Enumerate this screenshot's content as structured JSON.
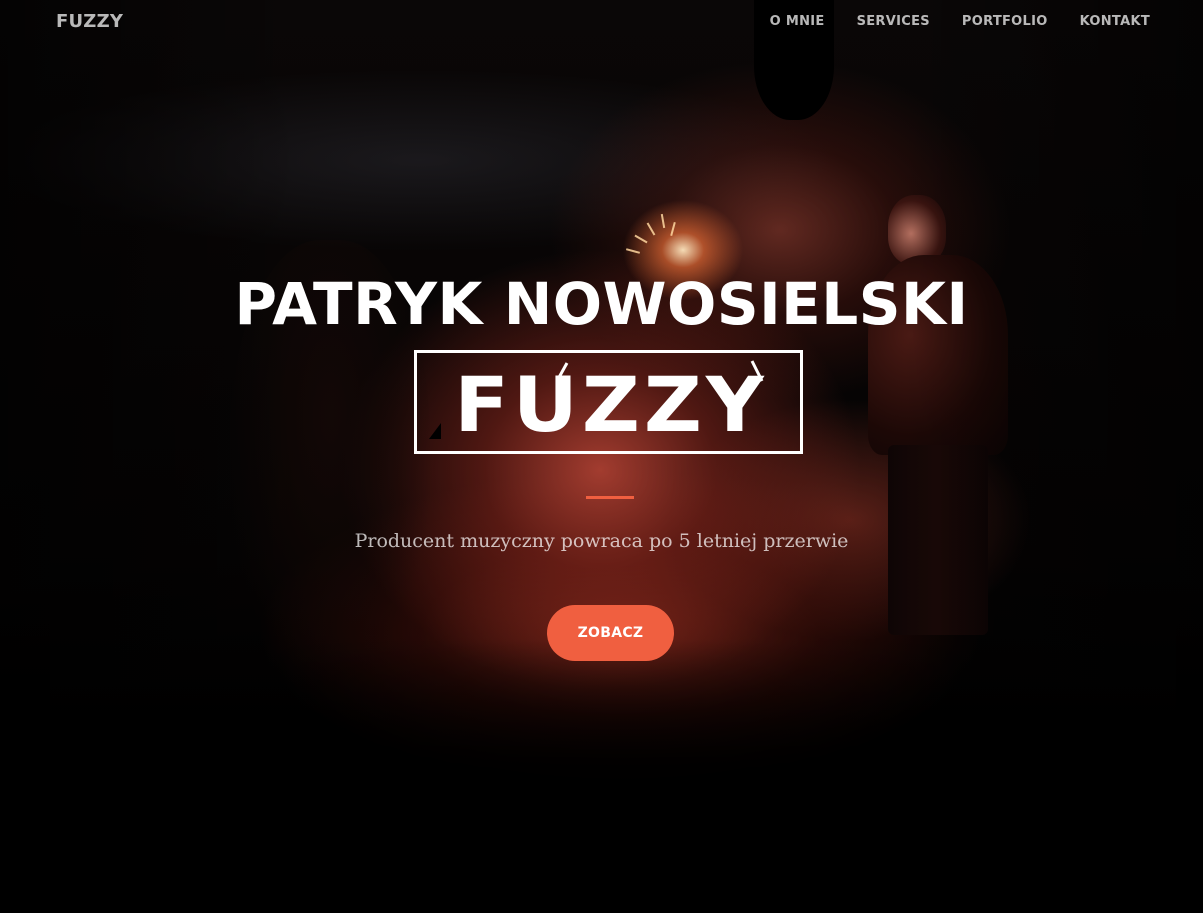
{
  "navbar": {
    "brand": "FUZZY",
    "links": [
      {
        "label": "O MNIE"
      },
      {
        "label": "SERVICES"
      },
      {
        "label": "PORTFOLIO"
      },
      {
        "label": "KONTAKT"
      }
    ]
  },
  "hero": {
    "title": "PATRYK NOWOSIELSKI",
    "logo_text": "FUZZY",
    "subtitle": "Producent muzyczny powraca po 5 letniej przerwie",
    "cta_label": "ZOBACZ"
  },
  "colors": {
    "accent": "#f05f40",
    "text": "#ffffff",
    "muted_text": "rgba(255,255,255,0.72)",
    "background": "#000000"
  }
}
